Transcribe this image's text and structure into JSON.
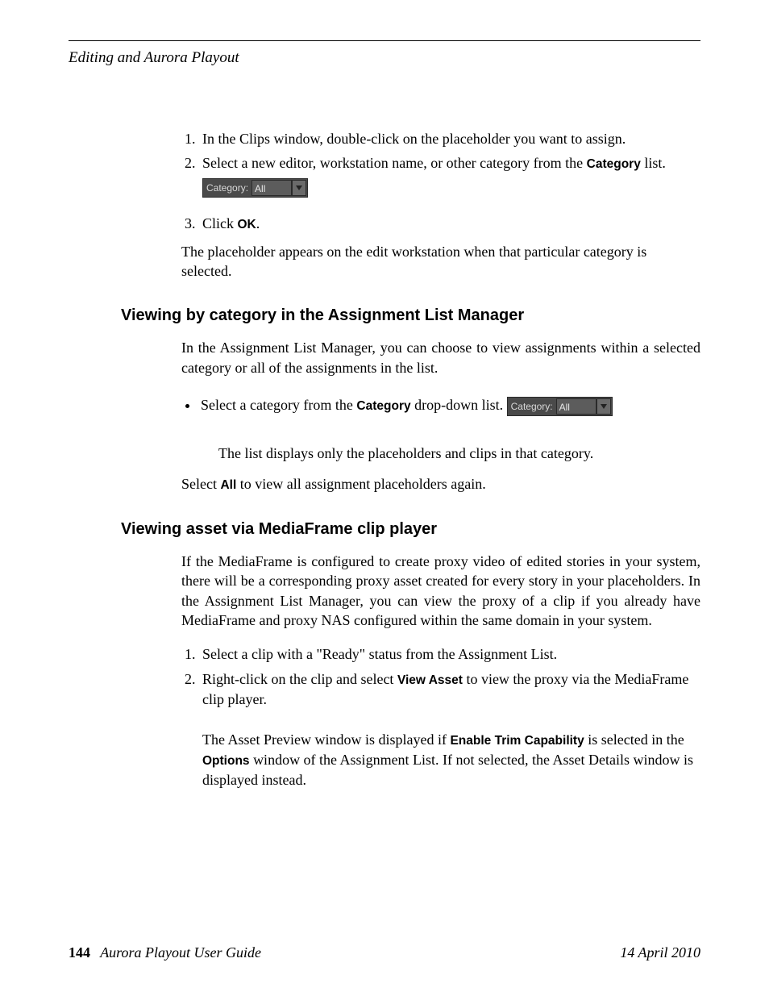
{
  "header": {
    "running_head": "Editing and Aurora Playout"
  },
  "section_intro": {
    "step1": "In the Clips window, double-click on the placeholder you want to assign.",
    "step2_pre": "Select a new editor, workstation name, or other category from the ",
    "step2_bold": "Category",
    "step2_post": " list.",
    "category_widget": {
      "label": "Category:",
      "value": "All"
    },
    "step3_pre": "Click ",
    "step3_bold": "OK",
    "step3_post": ".",
    "result": "The placeholder appears on the edit workstation when that particular category is selected."
  },
  "section_viewcat": {
    "heading": "Viewing by category in the Assignment List Manager",
    "intro": "In the Assignment List Manager, you can choose to view assignments within a selected category or all of the assignments in the list.",
    "bullet_pre": "Select a category from the ",
    "bullet_bold": "Category",
    "bullet_post": " drop-down list.",
    "category_widget": {
      "label": "Category:",
      "value": "All"
    },
    "sub_result": "The list displays only the placeholders and clips in that category.",
    "select_pre": "Select ",
    "select_bold": "All",
    "select_post": " to view all assignment placeholders again."
  },
  "section_viewasset": {
    "heading": "Viewing asset via MediaFrame clip player",
    "intro": "If the MediaFrame is configured to create proxy video of edited stories in your system, there will be a corresponding proxy asset created for every story in your placeholders. In the Assignment List Manager, you can view the proxy of a clip if you already have MediaFrame and proxy NAS configured within the same domain in your system.",
    "step1": "Select a clip with a \"Ready\" status from the Assignment List.",
    "step2_pre": "Right-click on the clip and select ",
    "step2_bold": "View Asset",
    "step2_post": " to view the proxy via the MediaFrame clip player.",
    "note_pre": "The Asset Preview window is displayed if ",
    "note_bold1": "Enable Trim Capability",
    "note_mid": " is selected in the ",
    "note_bold2": "Options",
    "note_post": " window of the Assignment List. If not selected, the Asset Details window is displayed instead."
  },
  "footer": {
    "page_number": "144",
    "doc_title": "Aurora Playout User Guide",
    "date": "14 April 2010"
  }
}
